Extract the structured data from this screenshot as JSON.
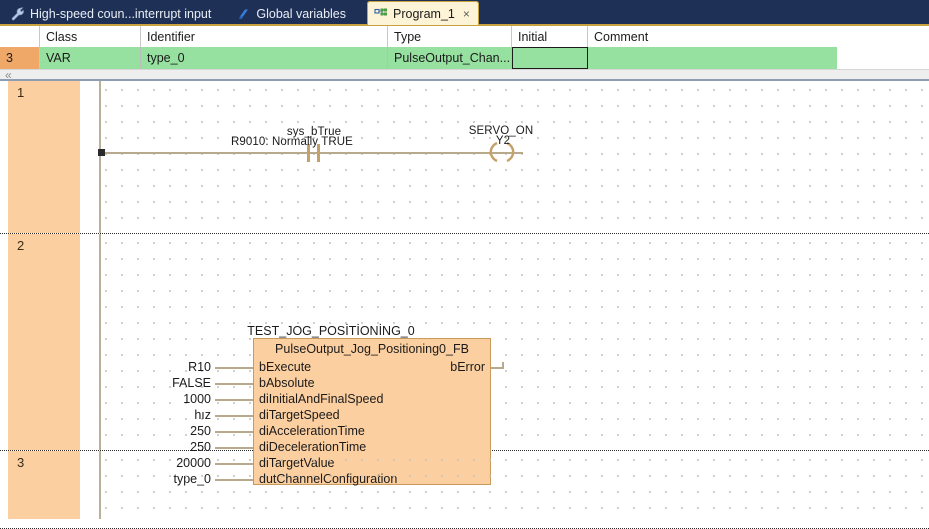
{
  "window": {
    "title": "Program_1"
  },
  "tabs": [
    {
      "label": "High-speed coun...interrupt input",
      "icon": "wrench-icon",
      "active": false,
      "closable": false
    },
    {
      "label": "Global variables",
      "icon": "variables-icon",
      "active": false,
      "closable": false
    },
    {
      "label": "Program_1",
      "icon": "ladder-program-icon",
      "active": true,
      "closable": true,
      "close_label": "×"
    }
  ],
  "variable_grid": {
    "columns": [
      "",
      "Class",
      "Identifier",
      "Type",
      "Initial",
      "Comment"
    ],
    "rows": [
      {
        "number": "3",
        "class": "VAR",
        "identifier": "type_0",
        "type": "PulseOutput_Chan...",
        "initial": "",
        "comment": "",
        "selected": true,
        "focused_cell": "Initial"
      }
    ],
    "scroll_left_indicator": "«"
  },
  "ladder": {
    "rungs": [
      {
        "number": "1",
        "contacts": [
          {
            "name_label": "sys_bTrue",
            "comment_label": "R9010: Normally TRUE",
            "type": "normally-open-contact"
          }
        ],
        "coils": [
          {
            "name_label": "SERVO_ON",
            "address_label": "Y2",
            "type": "output-coil"
          }
        ]
      },
      {
        "number": "2",
        "function_block": {
          "instance_name": "TEST_JOG_POSİTİONİNG_0",
          "type_name": "PulseOutput_Jog_Positioning0_FB",
          "inputs": [
            {
              "pin": "bExecute",
              "arg": "R10"
            },
            {
              "pin": "bAbsolute",
              "arg": "FALSE"
            },
            {
              "pin": "diInitialAndFinalSpeed",
              "arg": "1000"
            },
            {
              "pin": "diTargetSpeed",
              "arg": "hız"
            },
            {
              "pin": "diAccelerationTime",
              "arg": "250"
            },
            {
              "pin": "diDecelerationTime",
              "arg": "250"
            },
            {
              "pin": "diTargetValue",
              "arg": "20000"
            },
            {
              "pin": "dutChannelConfiguration",
              "arg": "type_0"
            }
          ],
          "outputs": [
            {
              "pin": "bError",
              "arg": ""
            }
          ]
        }
      },
      {
        "number": "3",
        "contacts": [],
        "coils": []
      }
    ]
  },
  "colors": {
    "tabbar_bg": "#1e3055",
    "active_tab_bg": "#fdf3d6",
    "accent_gold": "#c8a23c",
    "row_selected_green": "#96e0a0",
    "rung_header_orange": "#fbcfa0",
    "row_number_orange": "#f0a868",
    "fb_fill": "#fbcfa0",
    "wire": "#b8a98c"
  }
}
